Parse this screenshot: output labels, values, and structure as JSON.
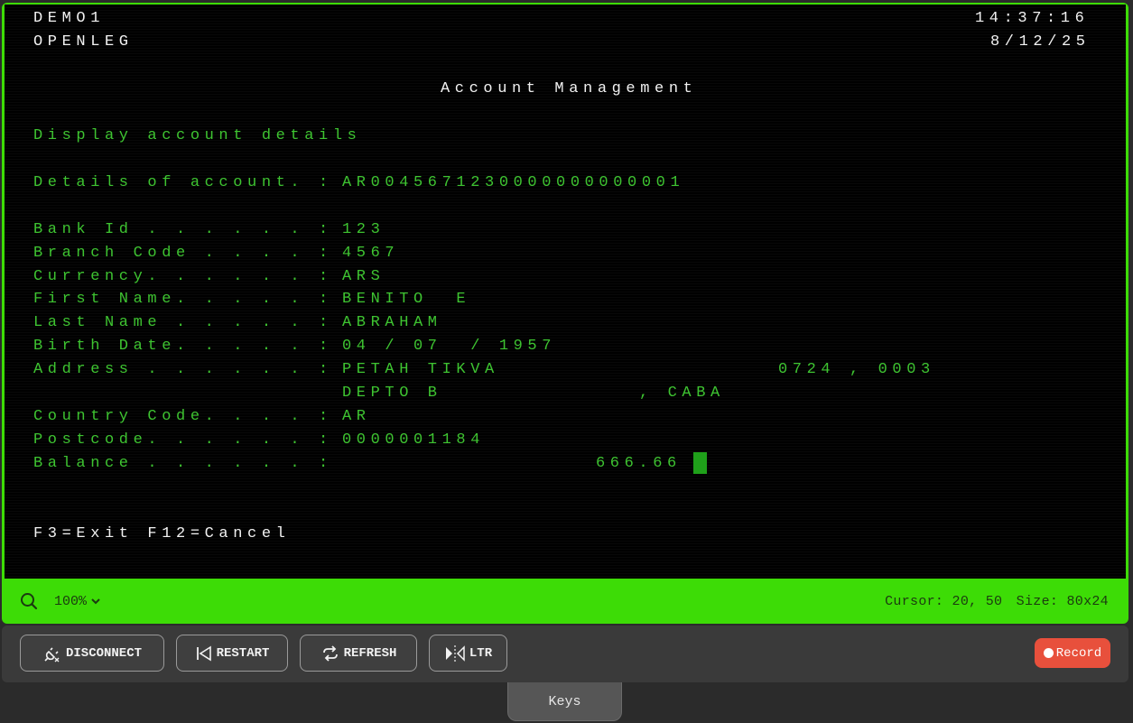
{
  "terminal": {
    "system_name": "DEMO1",
    "program_name": "OPENLEG",
    "time": "14:37:16",
    "date": "8/12/25",
    "title": "Account Management",
    "subtitle": "Display account details",
    "details_label": "Details of account. :",
    "account_number": "AR0045671230000000000001",
    "fields": [
      {
        "label": "Bank Id . . . . . . :",
        "value": "123"
      },
      {
        "label": "Branch Code . . . . :",
        "value": "4567"
      },
      {
        "label": "Currency. . . . . . :",
        "value": "ARS"
      },
      {
        "label": "First Name. . . . . :",
        "value": "BENITO  E"
      },
      {
        "label": "Last Name . . . . . :",
        "value": "ABRAHAM"
      },
      {
        "label": "Birth Date. . . . . :",
        "value": "04 / 07  / 1957"
      },
      {
        "label": "Address . . . . . . :",
        "value": "PETAH TIKVA"
      }
    ],
    "address_extra": "0724 , 0003",
    "address_line2": "DEPTO B",
    "address_line2_city": ", CABA",
    "fields2": [
      {
        "label": "Country Code. . . . :",
        "value": "AR"
      },
      {
        "label": "Postcode. . . . . . :",
        "value": "0000001184"
      },
      {
        "label": "Balance . . . . . . :",
        "value": "666.66"
      }
    ],
    "function_keys": "F3=Exit F12=Cancel"
  },
  "status_bar": {
    "zoom": "100%",
    "cursor_text": "Cursor: 20, 50",
    "size_text": "Size: 80x24"
  },
  "toolbar": {
    "disconnect_label": "DISCONNECT",
    "restart_label": "RESTART",
    "refresh_label": "REFRESH",
    "ltr_label": "LTR",
    "record_label": "Record"
  },
  "keys_tab_label": "Keys",
  "colors": {
    "accent_green": "#3ddc06",
    "terminal_green": "#3ec431",
    "record_red": "#e8503c"
  }
}
